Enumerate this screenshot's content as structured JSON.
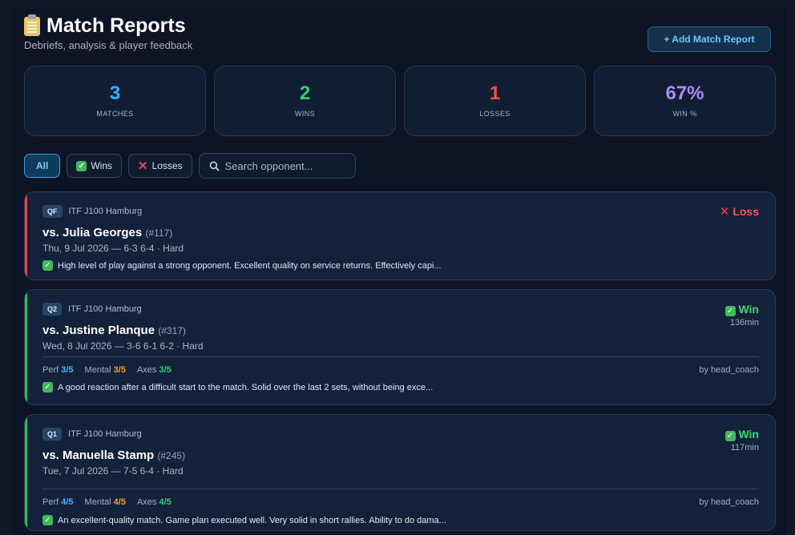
{
  "header": {
    "title": "Match Reports",
    "subtitle": "Debriefs, analysis & player feedback",
    "add_button": "+ Add Match Report"
  },
  "stats": [
    {
      "value": "3",
      "label": "MATCHES",
      "color": "#28b7ff"
    },
    {
      "value": "2",
      "label": "WINS",
      "color": "#2fd06d"
    },
    {
      "value": "1",
      "label": "LOSSES",
      "color": "#ff4d4d"
    },
    {
      "value": "67%",
      "label": "WIN %",
      "color": "#a78bfa"
    }
  ],
  "filters": {
    "all": "All",
    "wins": "Wins",
    "losses": "Losses",
    "search_placeholder": "Search opponent..."
  },
  "matches": [
    {
      "round": "QF",
      "tournament": "ITF J100 Hamburg",
      "opponent": "vs. Julia Georges",
      "rank": "(#117)",
      "date_score": "Thu, 9 Jul 2026 — 6-3 6-4 · Hard",
      "result": "Loss",
      "summary": "High level of play against a strong opponent. Excellent quality on service returns. Effectively capi..."
    },
    {
      "round": "Q2",
      "tournament": "ITF J100 Hamburg",
      "opponent": "vs. Justine Planque",
      "rank": "(#317)",
      "date_score": "Wed, 8 Jul 2026 — 3-6 6-1 6-2 · Hard",
      "result": "Win",
      "duration": "136min",
      "ratings": {
        "perf_label": "Perf",
        "perf": "3/5",
        "mental_label": "Mental",
        "mental": "3/5",
        "axes_label": "Axes",
        "axes": "3/5"
      },
      "author": "by head_coach",
      "summary": "A good reaction after a difficult start to the match. Solid over the last 2 sets, without being exce..."
    },
    {
      "round": "Q1",
      "tournament": "ITF J100 Hamburg",
      "opponent": "vs. Manuella Stamp",
      "rank": "(#245)",
      "date_score": "Tue, 7 Jul 2026 — 7-5 6-4 · Hard",
      "result": "Win",
      "duration": "117min",
      "ratings": {
        "perf_label": "Perf",
        "perf": "4/5",
        "mental_label": "Mental",
        "mental": "4/5",
        "axes_label": "Axes",
        "axes": "4/5"
      },
      "author": "by head_coach",
      "summary": "An excellent-quality match. Game plan executed well. Very solid in short rallies. Ability to do dama..."
    }
  ]
}
